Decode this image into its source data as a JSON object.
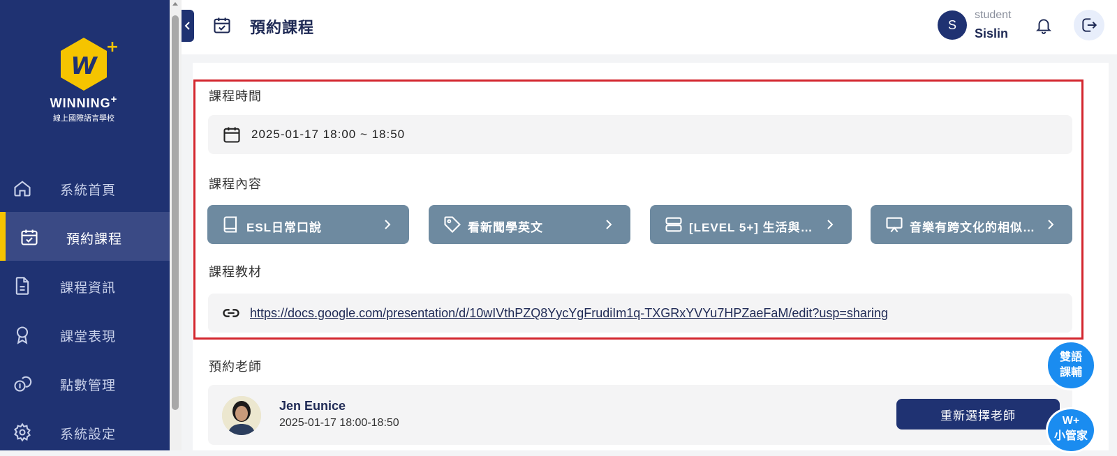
{
  "brand": {
    "logo_mark": "W",
    "name": "WINNING",
    "name_sup": "+",
    "subtitle": "線上國際語言學校",
    "accent": "#f5c400",
    "primary": "#1f3272"
  },
  "sidebar": {
    "items": [
      {
        "label": "系統首頁",
        "icon": "home-icon"
      },
      {
        "label": "預約課程",
        "icon": "calendar-check-icon",
        "active": true
      },
      {
        "label": "課程資訊",
        "icon": "document-icon"
      },
      {
        "label": "課堂表現",
        "icon": "award-icon"
      },
      {
        "label": "點數管理",
        "icon": "coins-icon"
      },
      {
        "label": "系統設定",
        "icon": "gear-icon"
      }
    ]
  },
  "header": {
    "title": "預約課程",
    "avatar_initial": "S",
    "user_role": "student",
    "user_name": "Sislin"
  },
  "sections": {
    "time_label": "課程時間",
    "time_value": "2025-01-17 18:00 ~ 18:50",
    "content_label": "課程內容",
    "chips": [
      {
        "label": "ESL日常口說",
        "icon": "book-icon"
      },
      {
        "label": "看新聞學英文",
        "icon": "tag-icon"
      },
      {
        "label": "[LEVEL 5+] 生活與文…",
        "icon": "server-icon"
      },
      {
        "label": "音樂有跨文化的相似…",
        "icon": "presentation-icon"
      }
    ],
    "material_label": "課程教材",
    "material_link": "https://docs.google.com/presentation/d/10wIVthPZQ8YycYgFrudiIm1q-TXGRxYVYu7HPZaeFaM/edit?usp=sharing",
    "teacher_label": "預約老師",
    "teacher_name": "Jen Eunice",
    "teacher_time": "2025-01-17 18:00-18:50",
    "reselect_button": "重新選擇老師"
  },
  "floating": {
    "bilingual_line1": "雙語",
    "bilingual_line2": "課輔",
    "assistant_line1": "W+",
    "assistant_line2": "小管家"
  }
}
